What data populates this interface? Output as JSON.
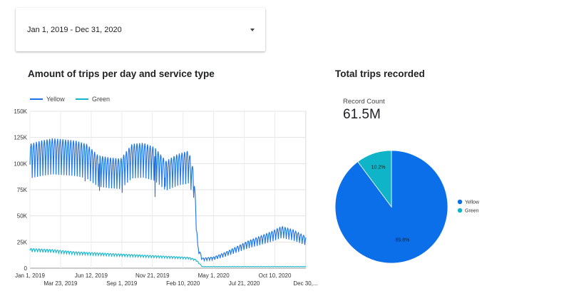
{
  "date_range": {
    "label": "Jan 1, 2019 - Dec 31, 2020",
    "icon": "dropdown-arrow-icon"
  },
  "line_chart": {
    "title": "Amount of trips per day and service type"
  },
  "scorecard": {
    "label": "Record Count",
    "value": "61.5M"
  },
  "pie_chart": {
    "title": "Total trips recorded"
  },
  "colors": {
    "yellow_series": "#1a73e8",
    "green_series": "#12b5cb",
    "pie_yellow": "#0a6fe8",
    "pie_green": "#10b4c8"
  },
  "chart_data": [
    {
      "type": "line",
      "title": "Amount of trips per day and service type",
      "xlabel": "",
      "ylabel": "",
      "ylim": [
        0,
        150000
      ],
      "y_ticks": [
        "0",
        "25K",
        "50K",
        "75K",
        "100K",
        "125K",
        "150K"
      ],
      "y_tick_values": [
        0,
        25000,
        50000,
        75000,
        100000,
        125000,
        150000
      ],
      "x_ticks_top_row": [
        "Jan 1, 2019",
        "Jun 12, 2019",
        "Nov 21, 2019",
        "May 1, 2020",
        "Oct 10, 2020"
      ],
      "x_ticks_bottom_row": [
        "Mar 23, 2019",
        "Sep 1, 2019",
        "Feb 10, 2020",
        "Jul 21, 2020",
        "Dec 30,..."
      ],
      "legend": [
        "Yellow",
        "Green"
      ],
      "legend_position": "top-left",
      "grid": true,
      "series": [
        {
          "name": "Yellow",
          "x": [
            "2019-01-01",
            "2019-01-31",
            "2019-03-02",
            "2019-04-01",
            "2019-05-01",
            "2019-05-31",
            "2019-06-30",
            "2019-07-30",
            "2019-08-29",
            "2019-09-28",
            "2019-10-28",
            "2019-11-27",
            "2019-12-27",
            "2020-01-26",
            "2020-02-25",
            "2020-03-10",
            "2020-03-20",
            "2020-04-01",
            "2020-05-01",
            "2020-05-31",
            "2020-06-30",
            "2020-07-30",
            "2020-08-29",
            "2020-09-28",
            "2020-10-28",
            "2020-11-27",
            "2020-12-31"
          ],
          "values": [
            110000,
            113000,
            115000,
            114000,
            113000,
            110000,
            100000,
            98000,
            97000,
            110000,
            111000,
            107000,
            95000,
            101000,
            104000,
            85000,
            20000,
            9000,
            10000,
            14000,
            19000,
            24000,
            28000,
            32000,
            37000,
            34000,
            28000
          ]
        },
        {
          "name": "Green",
          "x": [
            "2019-01-01",
            "2019-03-02",
            "2019-05-01",
            "2019-06-30",
            "2019-08-29",
            "2019-10-28",
            "2019-12-27",
            "2020-02-25",
            "2020-03-15",
            "2020-04-01",
            "2020-06-30",
            "2020-09-28",
            "2020-12-31"
          ],
          "values": [
            18000,
            17000,
            15000,
            14000,
            13000,
            12000,
            11000,
            10000,
            8000,
            1500,
            1500,
            1500,
            1500
          ]
        }
      ]
    },
    {
      "type": "pie",
      "title": "Total trips recorded",
      "legend": [
        "Yellow",
        "Green"
      ],
      "legend_position": "right",
      "slice_labels": [
        "89.8%",
        "10.2%"
      ],
      "series": [
        {
          "name": "Yellow",
          "values": [
            89.8
          ]
        },
        {
          "name": "Green",
          "values": [
            10.2
          ]
        }
      ]
    }
  ]
}
